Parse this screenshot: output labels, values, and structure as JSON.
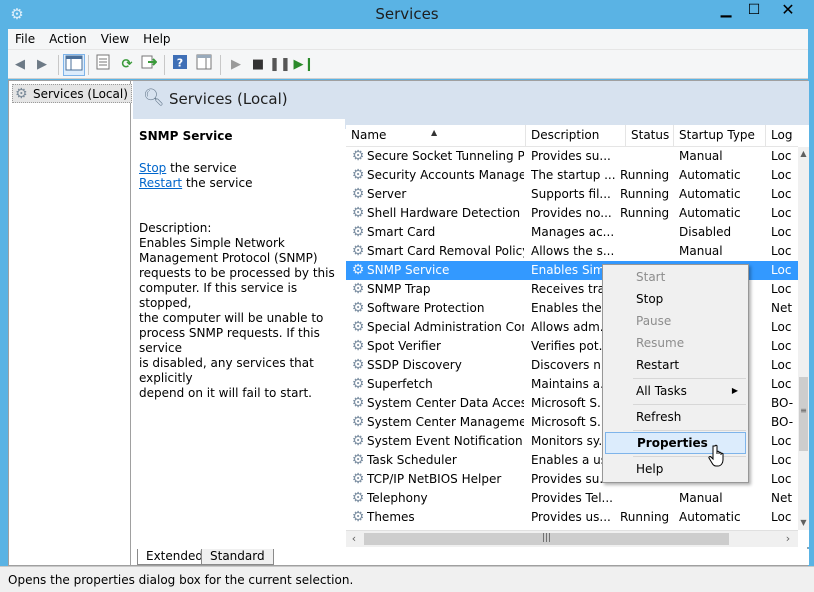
{
  "window": {
    "title": "Services"
  },
  "menu": [
    "File",
    "Action",
    "View",
    "Help"
  ],
  "tree": {
    "item": "Services (Local)"
  },
  "pane": {
    "title": "Services (Local)"
  },
  "detail": {
    "service_name": "SNMP Service",
    "stop_link": "Stop",
    "stop_suffix": " the service",
    "restart_link": "Restart",
    "restart_suffix": " the service",
    "description_label": "Description:",
    "description_lines": [
      "Enables Simple Network",
      "Management Protocol (SNMP)",
      "requests to be processed by this",
      "computer. If this service is stopped,",
      "the computer will be unable to",
      "process SNMP requests. If this service",
      "is disabled, any services that explicitly",
      "depend on it will fail to start."
    ]
  },
  "columns": {
    "name": "Name",
    "description": "Description",
    "status": "Status",
    "startup": "Startup Type",
    "logon": "Log"
  },
  "rows": [
    {
      "name": "Secure Socket Tunneling Pr...",
      "description": "Provides su...",
      "status": "",
      "startup": "Manual",
      "logon": "Loc"
    },
    {
      "name": "Security Accounts Manager",
      "description": "The startup ...",
      "status": "Running",
      "startup": "Automatic",
      "logon": "Loc"
    },
    {
      "name": "Server",
      "description": "Supports fil...",
      "status": "Running",
      "startup": "Automatic",
      "logon": "Loc"
    },
    {
      "name": "Shell Hardware Detection",
      "description": "Provides no...",
      "status": "Running",
      "startup": "Automatic",
      "logon": "Loc"
    },
    {
      "name": "Smart Card",
      "description": "Manages ac...",
      "status": "",
      "startup": "Disabled",
      "logon": "Loc"
    },
    {
      "name": "Smart Card Removal Policy",
      "description": "Allows the s...",
      "status": "",
      "startup": "Manual",
      "logon": "Loc"
    },
    {
      "name": "SNMP Service",
      "description": "Enables Sim...",
      "status": "",
      "startup": "",
      "logon": "Loc",
      "selected": true
    },
    {
      "name": "SNMP Trap",
      "description": "Receives tra...",
      "status": "",
      "startup": "",
      "logon": "Loc"
    },
    {
      "name": "Software Protection",
      "description": "Enables the ...",
      "status": "",
      "startup": "",
      "logon": "Net"
    },
    {
      "name": "Special Administration Con...",
      "description": "Allows adm...",
      "status": "",
      "startup": "",
      "logon": "Loc"
    },
    {
      "name": "Spot Verifier",
      "description": "Verifies pot...",
      "status": "",
      "startup": "",
      "logon": "Loc"
    },
    {
      "name": "SSDP Discovery",
      "description": "Discovers n...",
      "status": "",
      "startup": "",
      "logon": "Loc"
    },
    {
      "name": "Superfetch",
      "description": "Maintains a...",
      "status": "",
      "startup": "",
      "logon": "Loc"
    },
    {
      "name": "System Center Data Access ...",
      "description": "Microsoft S...",
      "status": "",
      "startup": "",
      "logon": "BO-"
    },
    {
      "name": "System Center Managemen...",
      "description": "Microsoft S...",
      "status": "",
      "startup": "",
      "logon": "BO-"
    },
    {
      "name": "System Event Notification S...",
      "description": "Monitors sy...",
      "status": "",
      "startup": "",
      "logon": "Loc"
    },
    {
      "name": "Task Scheduler",
      "description": "Enables a us...",
      "status": "",
      "startup": "",
      "logon": "Loc"
    },
    {
      "name": "TCP/IP NetBIOS Helper",
      "description": "Provides su...",
      "status": "",
      "startup": "",
      "logon": "Loc"
    },
    {
      "name": "Telephony",
      "description": "Provides Tel...",
      "status": "",
      "startup": "Manual",
      "logon": "Net"
    },
    {
      "name": "Themes",
      "description": "Provides us...",
      "status": "Running",
      "startup": "Automatic",
      "logon": "Loc"
    }
  ],
  "context_menu": [
    {
      "label": "Start",
      "disabled": true
    },
    {
      "label": "Stop",
      "disabled": false
    },
    {
      "label": "Pause",
      "disabled": true
    },
    {
      "label": "Resume",
      "disabled": true
    },
    {
      "label": "Restart",
      "disabled": false
    },
    {
      "label": "All Tasks",
      "disabled": false,
      "submenu": true
    },
    {
      "label": "Refresh",
      "disabled": false
    },
    {
      "label": "Properties",
      "disabled": false,
      "highlighted": true
    },
    {
      "label": "Help",
      "disabled": false
    }
  ],
  "tabs": [
    "Extended",
    "Standard"
  ],
  "status_bar": "Opens the properties dialog box for the current selection."
}
